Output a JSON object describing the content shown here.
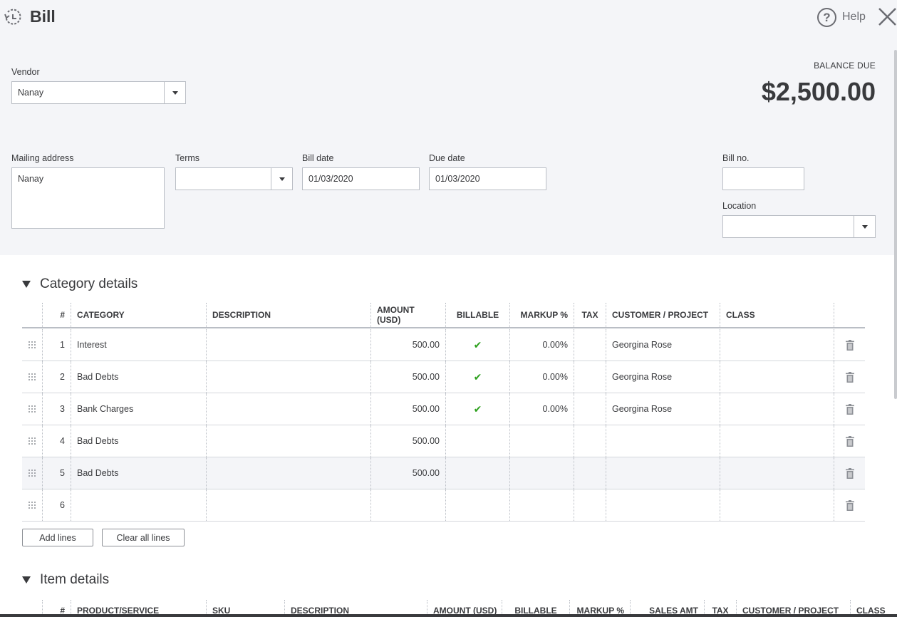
{
  "header": {
    "title": "Bill",
    "help_label": "Help"
  },
  "vendor": {
    "label": "Vendor",
    "value": "Nanay"
  },
  "balance": {
    "label": "BALANCE DUE",
    "amount": "$2,500.00"
  },
  "mailing": {
    "label": "Mailing address",
    "value": "Nanay"
  },
  "terms": {
    "label": "Terms",
    "value": ""
  },
  "bill_date": {
    "label": "Bill date",
    "value": "01/03/2020"
  },
  "due_date": {
    "label": "Due date",
    "value": "01/03/2020"
  },
  "bill_no": {
    "label": "Bill no.",
    "value": ""
  },
  "location": {
    "label": "Location",
    "value": ""
  },
  "category": {
    "title": "Category details",
    "columns": [
      "#",
      "CATEGORY",
      "DESCRIPTION",
      "AMOUNT (USD)",
      "BILLABLE",
      "MARKUP %",
      "TAX",
      "CUSTOMER / PROJECT",
      "CLASS"
    ],
    "rows": [
      {
        "num": "1",
        "category": "Interest",
        "description": "",
        "amount": "500.00",
        "billable": "✔",
        "markup": "0.00%",
        "tax": "",
        "customer": "Georgina Rose",
        "class": ""
      },
      {
        "num": "2",
        "category": "Bad Debts",
        "description": "",
        "amount": "500.00",
        "billable": "✔",
        "markup": "0.00%",
        "tax": "",
        "customer": "Georgina Rose",
        "class": ""
      },
      {
        "num": "3",
        "category": "Bank Charges",
        "description": "",
        "amount": "500.00",
        "billable": "✔",
        "markup": "0.00%",
        "tax": "",
        "customer": "Georgina Rose",
        "class": ""
      },
      {
        "num": "4",
        "category": "Bad Debts",
        "description": "",
        "amount": "500.00",
        "billable": "",
        "markup": "",
        "tax": "",
        "customer": "",
        "class": ""
      },
      {
        "num": "5",
        "category": "Bad Debts",
        "description": "",
        "amount": "500.00",
        "billable": "",
        "markup": "",
        "tax": "",
        "customer": "",
        "class": ""
      },
      {
        "num": "6",
        "category": "",
        "description": "",
        "amount": "",
        "billable": "",
        "markup": "",
        "tax": "",
        "customer": "",
        "class": ""
      }
    ],
    "add_lines": "Add lines",
    "clear_lines": "Clear all lines"
  },
  "items": {
    "title": "Item details",
    "columns": [
      "#",
      "PRODUCT/SERVICE",
      "SKU",
      "DESCRIPTION",
      "AMOUNT (USD)",
      "BILLABLE",
      "MARKUP %",
      "SALES AMT",
      "TAX",
      "CUSTOMER / PROJECT",
      "CLASS"
    ]
  }
}
